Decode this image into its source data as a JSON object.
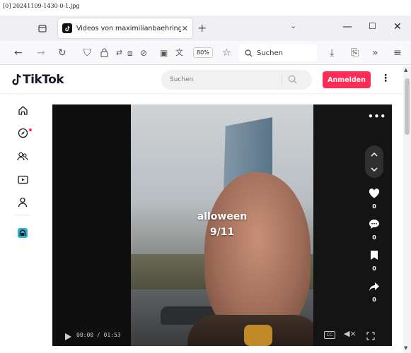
{
  "file_label": "[0] 20241109-1430-0-1.jpg",
  "browser": {
    "tab_title": "Videos von maximilianbaehring",
    "tab_close": "✕",
    "new_tab": "+",
    "tab_menu": "⌄",
    "win_min": "—",
    "win_max": "☐",
    "win_close": "✕",
    "zoom": "80%",
    "search_label": "Suchen"
  },
  "tiktok": {
    "logo_text": "TikTok",
    "search_placeholder": "Suchen",
    "login_label": "Anmelden",
    "more_label": "⋮"
  },
  "video": {
    "overlay_line1": "alloween",
    "overlay_line2": "9/11",
    "time": "00:00 / 01:53",
    "cc_label": "CC",
    "vol_label": "◀×",
    "more_dots": "•••",
    "actions": [
      {
        "name": "like",
        "count": "0"
      },
      {
        "name": "comment",
        "count": "0"
      },
      {
        "name": "bookmark",
        "count": "0"
      },
      {
        "name": "share",
        "count": "0"
      }
    ]
  },
  "colors": {
    "brand_red": "#fe2c55",
    "chrome_bg": "#f0f0f4"
  }
}
